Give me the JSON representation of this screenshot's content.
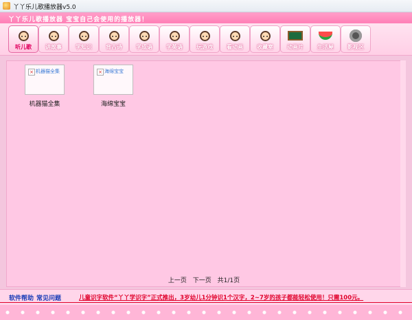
{
  "window": {
    "title": "丫丫乐儿歌播放器v5.0"
  },
  "banner": {
    "slogan": "丫丫乐儿歌播放器  宝宝自己会使用的播放器！"
  },
  "tabs": [
    {
      "label": "听儿歌",
      "icon": "girl-headphones-icon",
      "active": true
    },
    {
      "label": "讲故事",
      "icon": "boy-reading-icon"
    },
    {
      "label": "学知识",
      "icon": "girl-writing-icon"
    },
    {
      "label": "背古诗",
      "icon": "girl-reciting-icon"
    },
    {
      "label": "学成语",
      "icon": "girl-book-icon"
    },
    {
      "label": "学英语",
      "icon": "girl-english-icon"
    },
    {
      "label": "玩游戏",
      "icon": "boy-playing-icon"
    },
    {
      "label": "看动画",
      "icon": "girl-watching-icon"
    },
    {
      "label": "收藏室",
      "icon": "princess-icon"
    },
    {
      "label": "动画片",
      "icon": "blackboard-icon"
    },
    {
      "label": "生活屋",
      "icon": "watermelon-icon"
    },
    {
      "label": "影视区",
      "icon": "film-reel-icon"
    }
  ],
  "items": [
    {
      "thumb_alt": "机器猫全集",
      "caption": "机器猫全集"
    },
    {
      "thumb_alt": "海绵宝宝",
      "caption": "海绵宝宝"
    }
  ],
  "pager": {
    "prev": "上一页",
    "next": "下一页",
    "summary": "共1/1页"
  },
  "footer": {
    "help": "软件帮助",
    "faq": "常见问题",
    "marquee": "儿童识字软件“丫丫学识字”正式推出，3岁幼儿1分钟识1个汉字，2~7岁的孩子都能轻松使用！只需100元。"
  }
}
